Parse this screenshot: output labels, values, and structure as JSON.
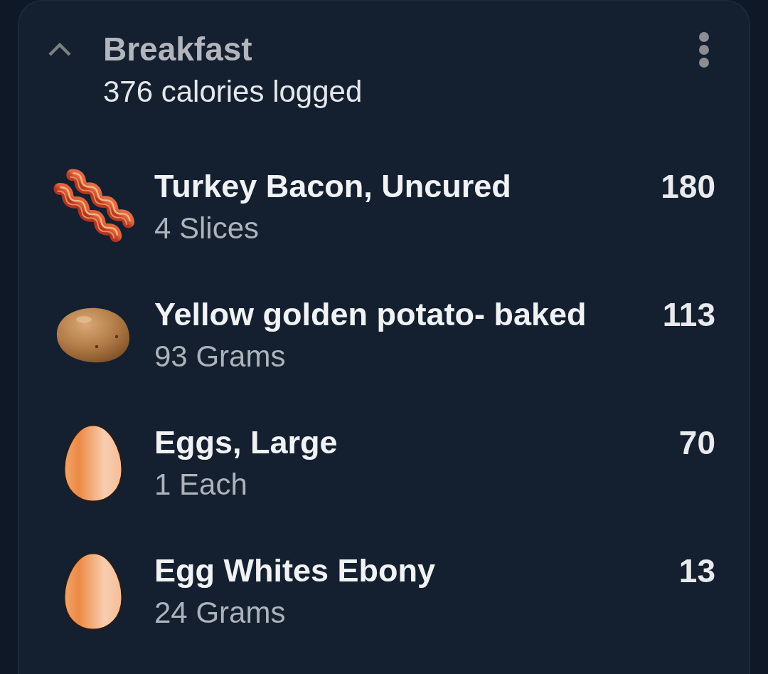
{
  "meal": {
    "title": "Breakfast",
    "summary": "376 calories logged",
    "expanded": true
  },
  "items": [
    {
      "kind": "bacon",
      "name": "Turkey Bacon, Uncured",
      "serving": "4 Slices",
      "calories": "180"
    },
    {
      "kind": "potato",
      "name": "Yellow golden potato- baked",
      "serving": "93 Grams",
      "calories": "113"
    },
    {
      "kind": "egg",
      "name": "Eggs, Large",
      "serving": "1 Each",
      "calories": "70"
    },
    {
      "kind": "egg",
      "name": "Egg Whites Ebony",
      "serving": "24 Grams",
      "calories": "13"
    }
  ]
}
